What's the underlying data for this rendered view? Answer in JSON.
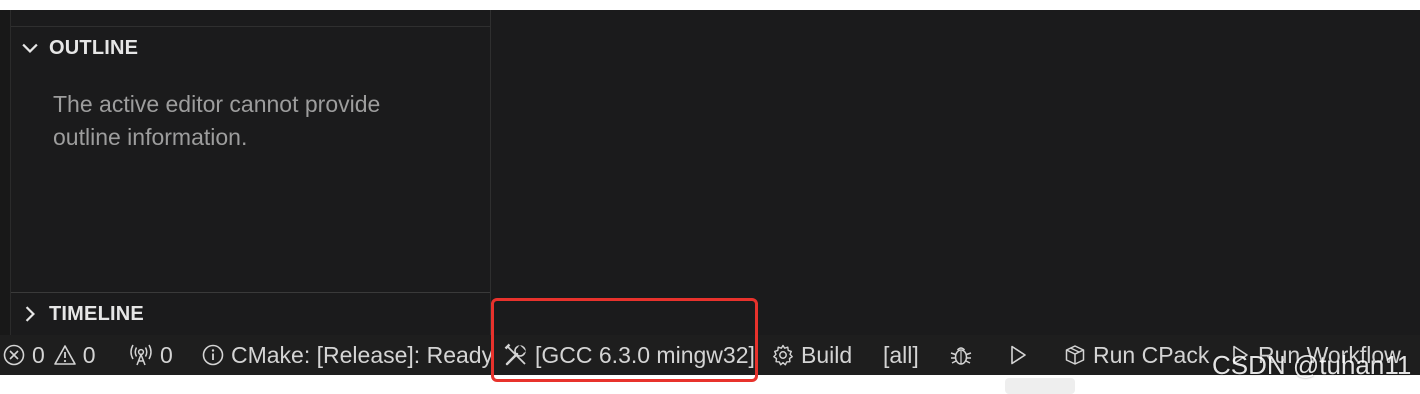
{
  "sidebar": {
    "outline": {
      "title": "OUTLINE",
      "message": "The active editor cannot provide outline information."
    },
    "timeline": {
      "title": "TIMELINE"
    }
  },
  "statusbar": {
    "errors": "0",
    "warnings": "0",
    "ports": "0",
    "cmake_status": "CMake: [Release]: Ready",
    "kit": "[GCC 6.3.0 mingw32]",
    "build": "Build",
    "build_target": "[all]",
    "run_cpack": "Run CPack",
    "run_workflow": "Run Workflow"
  },
  "watermark": "CSDN @tuhan11",
  "icons": {
    "outline_chevron": "chevron-down-icon",
    "timeline_chevron": "chevron-right-icon",
    "errors": "error-circle-icon",
    "warnings": "warning-triangle-icon",
    "ports": "broadcast-icon",
    "info": "info-icon",
    "kit": "tools-icon",
    "build": "gear-icon",
    "debug": "bug-icon",
    "launch": "play-icon",
    "cpack": "package-icon",
    "workflow": "play-icon"
  },
  "colors": {
    "highlight": "#e8322c",
    "background": "#1b1b1c",
    "statusbar": "#1e1e1e"
  }
}
